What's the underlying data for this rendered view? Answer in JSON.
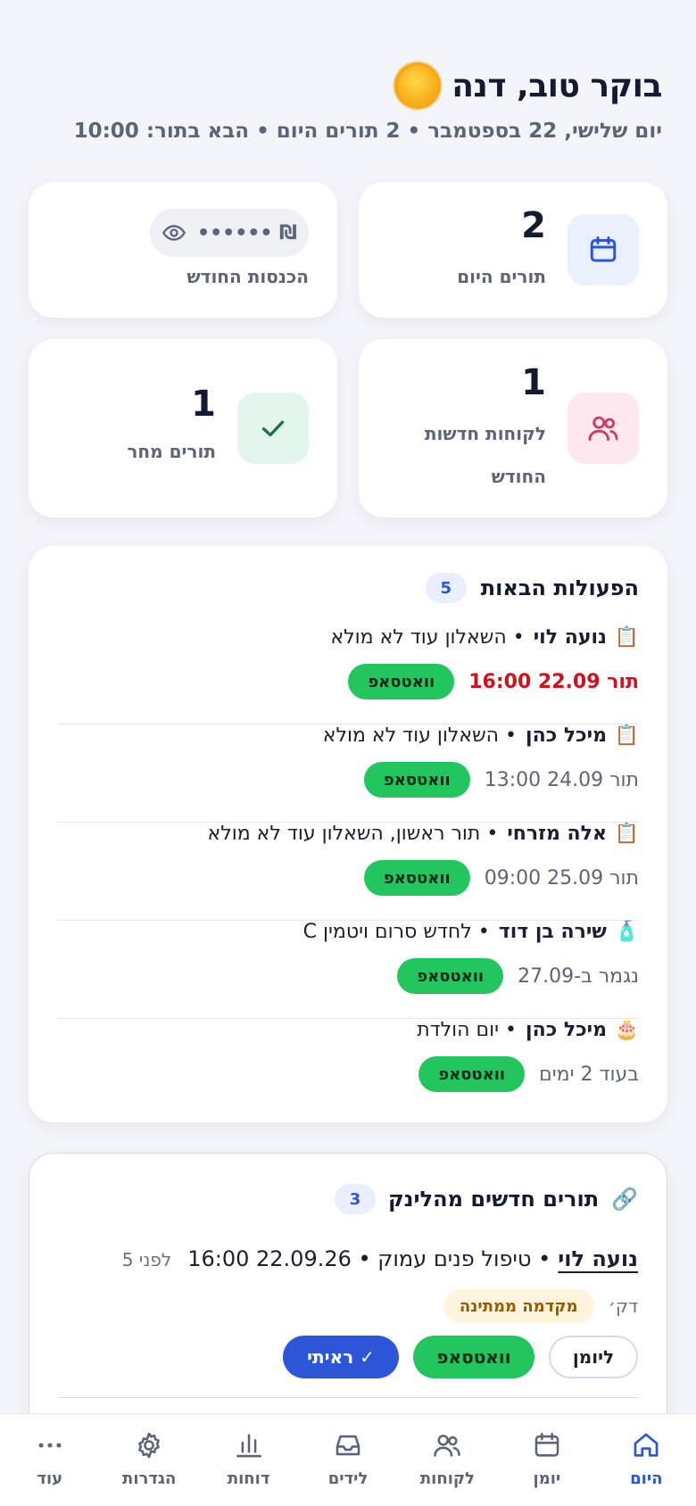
{
  "header": {
    "greeting": "בוקר טוב, דנה",
    "subline": "יום שלישי, 22 בספטמבר • 2 תורים היום • הבא בתור: 10:00"
  },
  "stats": {
    "today": {
      "value": "2",
      "label": "תורים היום",
      "icon": "calendar-icon"
    },
    "revenue": {
      "masked": "₪ ••••••",
      "label": "הכנסות החודש",
      "icon": "eye-icon"
    },
    "new_clients": {
      "value": "1",
      "label_line1": "לקוחות חדשות",
      "label_line2": "החודש",
      "icon": "users-icon"
    },
    "tomorrow": {
      "value": "1",
      "label": "תורים מחר",
      "icon": "check-icon"
    }
  },
  "actions": {
    "title": "הפעולות הבאות",
    "count": "5",
    "items": [
      {
        "emoji": "📋",
        "name": "נועה לוי",
        "text": "• השאלון עוד לא מולא",
        "when": "תור 22.09 16:00",
        "urgent": true,
        "button": "וואטסאפ"
      },
      {
        "emoji": "📋",
        "name": "מיכל כהן",
        "text": "• השאלון עוד לא מולא",
        "when": "תור 24.09 13:00",
        "urgent": false,
        "button": "וואטסאפ"
      },
      {
        "emoji": "📋",
        "name": "אלה מזרחי",
        "text": "• תור ראשון, השאלון עוד לא מולא",
        "when": "תור 25.09 09:00",
        "urgent": false,
        "button": "וואטסאפ"
      },
      {
        "emoji": "🧴",
        "name": "שירה בן דוד",
        "text": "• לחדש סרום ויטמין C",
        "when": "נגמר ב-27.09",
        "urgent": false,
        "button": "וואטסאפ"
      },
      {
        "emoji": "🎂",
        "name": "מיכל כהן",
        "text": "• יום הולדת",
        "when": "בעוד 2 ימים",
        "urgent": false,
        "button": "וואטסאפ"
      }
    ]
  },
  "link_bookings": {
    "title": "תורים חדשים מהלינק",
    "count": "3",
    "emoji": "🔗",
    "item": {
      "name": "נועה לוי",
      "text": "• טיפול פנים עמוק • 22.09.26 16:00",
      "ago": "לפני 5",
      "ago_unit": "דק׳",
      "deposit": "מקדמה ממתינה",
      "btn_calendar": "ליומן",
      "btn_whatsapp": "וואטסאפ",
      "btn_seen": "✓ ראיתי"
    }
  },
  "nav": [
    {
      "label": "היום",
      "icon": "home-icon",
      "active": true
    },
    {
      "label": "יומן",
      "icon": "calendar-icon",
      "active": false
    },
    {
      "label": "לקוחות",
      "icon": "users-icon",
      "active": false
    },
    {
      "label": "לידים",
      "icon": "inbox-icon",
      "active": false
    },
    {
      "label": "דוחות",
      "icon": "bar-chart-icon",
      "active": false
    },
    {
      "label": "הגדרות",
      "icon": "gear-icon",
      "active": false
    },
    {
      "label": "עוד",
      "icon": "more-icon",
      "active": false
    }
  ],
  "colors": {
    "accent": "#2d55d8",
    "whatsapp": "#22c55e",
    "urgent": "#d0101e",
    "background": "#f3f5fa"
  }
}
